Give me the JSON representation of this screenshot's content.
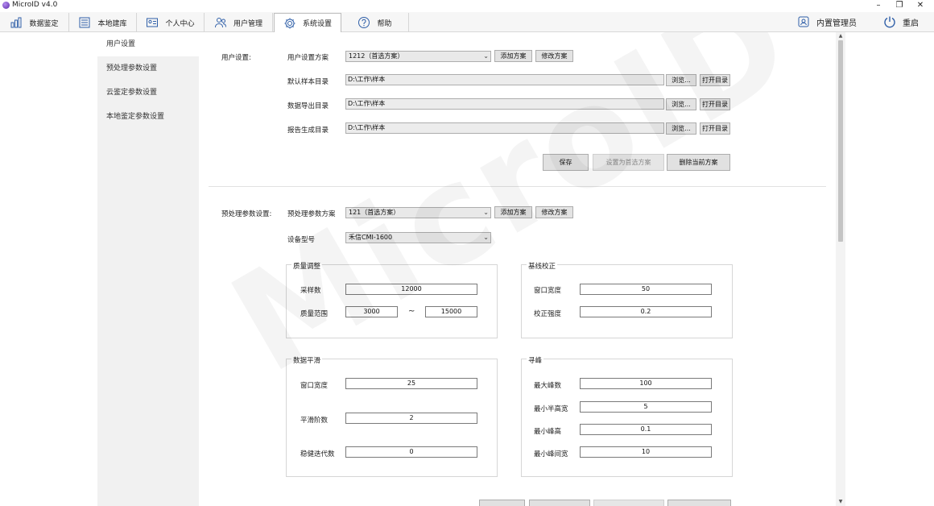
{
  "window": {
    "title": "MicroID v4.0",
    "controls": [
      "–",
      "❐",
      "✕"
    ]
  },
  "tabs": [
    {
      "label": "数据鉴定",
      "icon": "bar-chart-icon",
      "active": false
    },
    {
      "label": "本地建库",
      "icon": "database-list-icon",
      "active": false
    },
    {
      "label": "个人中心",
      "icon": "id-card-icon",
      "active": false
    },
    {
      "label": "用户管理",
      "icon": "users-icon",
      "active": false
    },
    {
      "label": "系统设置",
      "icon": "gear-icon",
      "active": true
    },
    {
      "label": "帮助",
      "icon": "help-icon",
      "active": false
    }
  ],
  "header": {
    "user_label": "内置管理员",
    "restart_label": "重启"
  },
  "sidebar": {
    "items": [
      {
        "label": "用户设置",
        "active": true
      },
      {
        "label": "预处理参数设置",
        "active": false
      },
      {
        "label": "云鉴定参数设置",
        "active": false
      },
      {
        "label": "本地鉴定参数设置",
        "active": false
      }
    ]
  },
  "user_settings": {
    "section_label": "用户设置:",
    "scheme_label": "用户设置方案",
    "scheme_value": "1212（首选方案）",
    "add_scheme": "添加方案",
    "edit_scheme": "修改方案",
    "rows": [
      {
        "label": "默认样本目录",
        "value": "D:\\工作\\样本",
        "browse": "浏览...",
        "open": "打开目录"
      },
      {
        "label": "数据导出目录",
        "value": "D:\\工作\\样本",
        "browse": "浏览...",
        "open": "打开目录"
      },
      {
        "label": "报告生成目录",
        "value": "D:\\工作\\样本",
        "browse": "浏览...",
        "open": "打开目录"
      }
    ],
    "save": "保存",
    "set_preferred": "设置为首选方案",
    "delete": "删除当前方案"
  },
  "preprocess": {
    "section_label": "预处理参数设置:",
    "scheme_label": "预处理参数方案",
    "scheme_value": "121（首选方案）",
    "add_scheme": "添加方案",
    "edit_scheme": "修改方案",
    "device_label": "设备型号",
    "device_value": "禾信CMI-1600",
    "mass_adjust": {
      "title": "质量调整",
      "sample_label": "采样数",
      "sample_value": "12000",
      "range_label": "质量范围",
      "range_min": "3000",
      "range_sep": "~",
      "range_max": "15000"
    },
    "baseline": {
      "title": "基线校正",
      "window_label": "窗口宽度",
      "window_value": "50",
      "strength_label": "校正强度",
      "strength_value": "0.2"
    },
    "smoothing": {
      "title": "数据平滑",
      "window_label": "窗口宽度",
      "window_value": "25",
      "order_label": "平滑阶数",
      "order_value": "2",
      "iter_label": "稳健迭代数",
      "iter_value": "0"
    },
    "peak": {
      "title": "寻峰",
      "max_peaks_label": "最大峰数",
      "max_peaks_value": "100",
      "min_half_label": "最小半高宽",
      "min_half_value": "5",
      "min_height_label": "最小峰高",
      "min_height_value": "0.1",
      "min_gap_label": "最小峰间宽",
      "min_gap_value": "10"
    }
  },
  "watermark": "MicroID"
}
